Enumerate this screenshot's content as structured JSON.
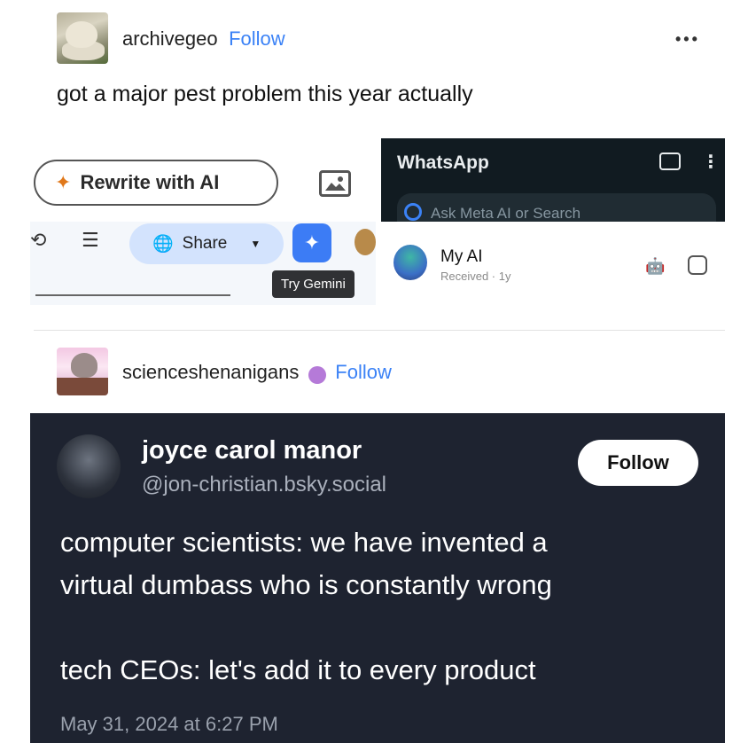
{
  "post1": {
    "username": "archivegeo",
    "follow_label": "Follow",
    "more_label": "•••",
    "text": "got a major pest problem this year actually"
  },
  "collage": {
    "rewrite_label": "Rewrite with AI",
    "share_label": "Share",
    "tooltip": "Try Gemini",
    "whatsapp_title": "WhatsApp",
    "whatsapp_search_placeholder": "Ask Meta AI or Search",
    "chat_name": "My AI",
    "chat_status": "Received · 1y"
  },
  "post2": {
    "username": "scienceshenanigans",
    "follow_label": "Follow"
  },
  "tweet": {
    "name": "joyce carol manor",
    "handle": "@jon-christian.bsky.social",
    "follow_label": "Follow",
    "line1": "computer scientists: we have invented a",
    "line2": "virtual dumbass who is constantly wrong",
    "line3": "tech CEOs: let's add it to every product",
    "date": "May 31, 2024 at 6:27 PM"
  },
  "icons": [
    "more-icon",
    "sparkle-icon",
    "image-icon",
    "share-globe-icon",
    "gemini-star-icon",
    "camera-icon",
    "kebab-icon",
    "meta-ai-ring-icon",
    "robot-icon",
    "scan-icon"
  ],
  "colors": {
    "follow_blue": "#3b82f6",
    "tweet_bg": "#1e2330",
    "whatsapp_bg": "#111b21",
    "share_bg": "#d3e3fd",
    "gemini_blue": "#3c7cf5"
  }
}
